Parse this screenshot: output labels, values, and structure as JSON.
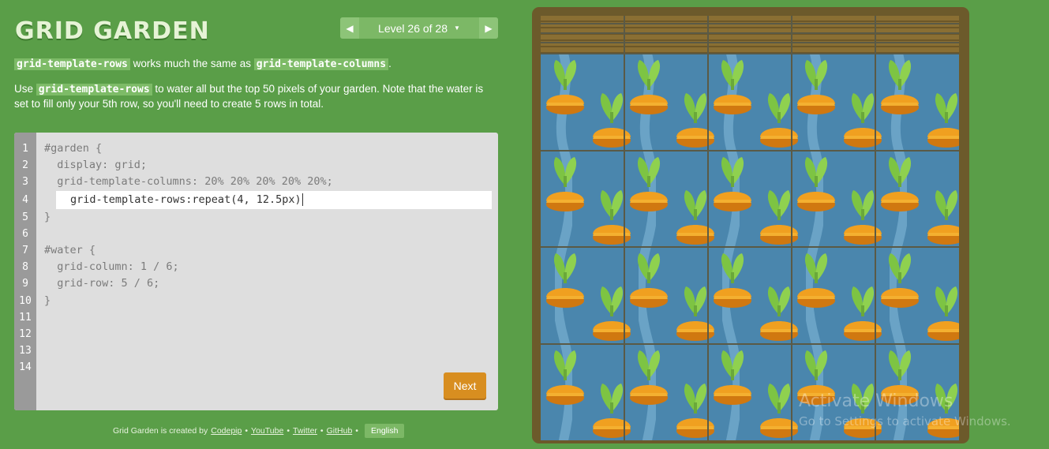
{
  "app": {
    "title": "GRID GARDEN"
  },
  "level_nav": {
    "prev_icon": "triangle-left-icon",
    "next_icon": "triangle-right-icon",
    "label": "Level 26 of 28",
    "caret": "▼"
  },
  "instructions": {
    "p1_code_a": "grid-template-rows",
    "p1_text_a": " works much the same as ",
    "p1_code_b": "grid-template-columns",
    "p1_text_b": ".",
    "p2_text_a": "Use ",
    "p2_code": "grid-template-rows",
    "p2_text_b": " to water all but the top 50 pixels of your garden. Note that the water is set to fill only your 5th row, so you'll need to create 5 rows in total."
  },
  "editor": {
    "line_numbers": [
      "1",
      "2",
      "3",
      "4",
      "5",
      "6",
      "7",
      "8",
      "9",
      "10",
      "11",
      "12",
      "13",
      "14"
    ],
    "lines_before": [
      "#garden {",
      "  display: grid;",
      "  grid-template-columns: 20% 20% 20% 20% 20%;"
    ],
    "input_value": "grid-template-rows:repeat(4, 12.5px)",
    "lines_after": [
      "}",
      "",
      "#water {",
      "  grid-column: 1 / 6;",
      "  grid-row: 5 / 6;",
      "}"
    ],
    "next_label": "Next"
  },
  "footer": {
    "prefix": "Grid Garden is created by ",
    "codepip": "Codepip",
    "youtube": "YouTube",
    "twitter": "Twitter",
    "github": "GitHub",
    "bullet": "•",
    "language": "English"
  },
  "watermark": {
    "line1": "Activate Windows",
    "line2": "Go to Settings to activate Windows."
  },
  "colors": {
    "background": "#5a9e48",
    "water": "#4a86ad",
    "soil": "#8a6f33",
    "carrot": "#f0a020",
    "leaf": "#7dc443",
    "next_button": "#d88e20"
  }
}
